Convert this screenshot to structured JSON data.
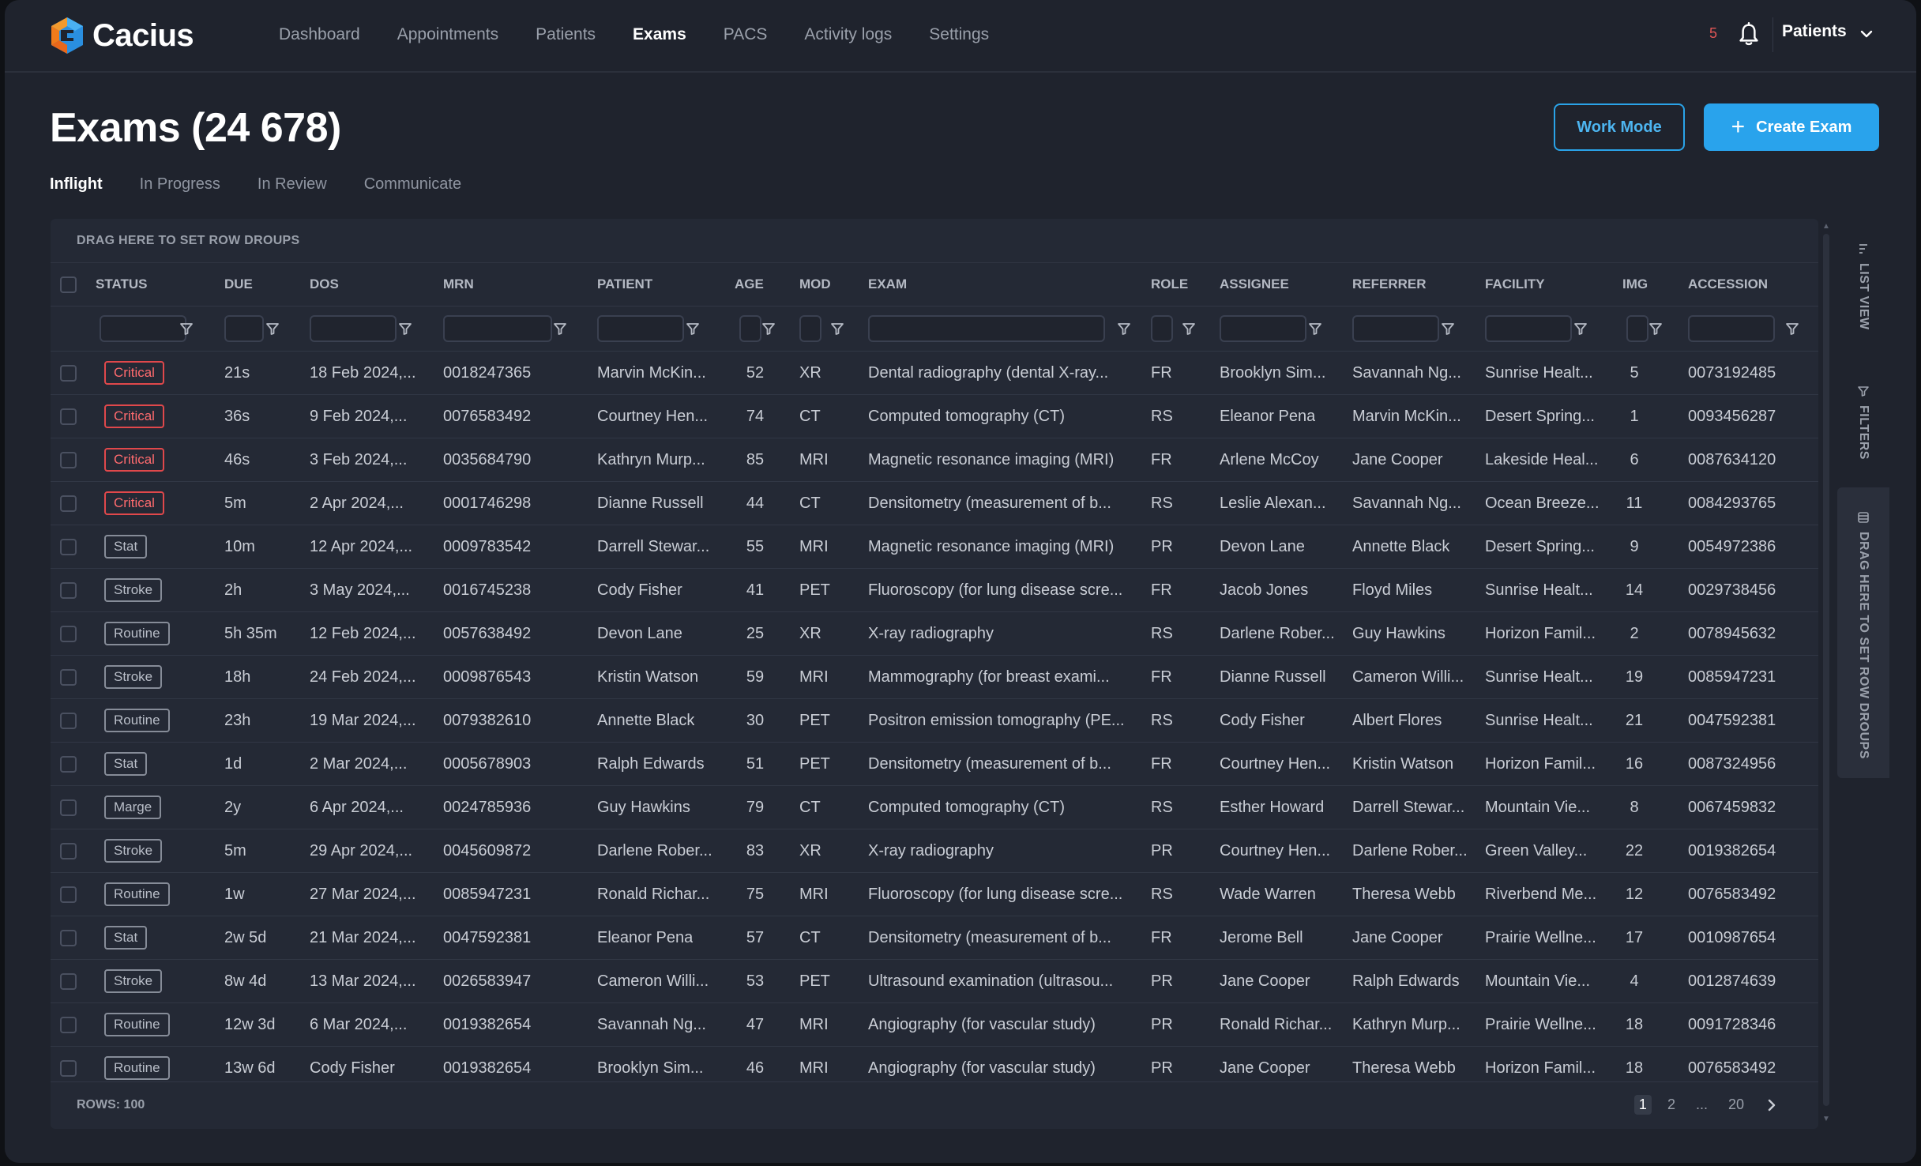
{
  "app": {
    "brand": "Cacius",
    "nav": [
      "Dashboard",
      "Appointments",
      "Patients",
      "Exams",
      "PACS",
      "Activity logs",
      "Settings"
    ],
    "nav_active": "Exams",
    "notification_count": "5",
    "profile_label": "Patients"
  },
  "page": {
    "title": "Exams (24 678)",
    "work_mode_label": "Work Mode",
    "create_label": "Create Exam",
    "tabs": [
      "Inflight",
      "In Progress",
      "In Review",
      "Communicate"
    ],
    "active_tab": "Inflight"
  },
  "grid": {
    "drop_zone_label": "DRAG HERE TO SET ROW DROUPS",
    "columns": [
      "STATUS",
      "DUE",
      "DOS",
      "MRN",
      "PATIENT",
      "AGE",
      "MOD",
      "EXAM",
      "ROLE",
      "ASSIGNEE",
      "REFERRER",
      "FACILITY",
      "IMG",
      "ACCESSION"
    ],
    "rows": [
      {
        "status": "Critical",
        "due": "21s",
        "dos": "18 Feb 2024,...",
        "mrn": "0018247365",
        "patient": "Marvin McKin...",
        "age": "52",
        "mod": "XR",
        "exam": "Dental radiography (dental X-ray...",
        "role": "FR",
        "assignee": "Brooklyn Sim...",
        "referrer": "Savannah Ng...",
        "facility": "Sunrise Healt...",
        "img": "5",
        "accession": "0073192485"
      },
      {
        "status": "Critical",
        "due": "36s",
        "dos": "9 Feb 2024,...",
        "mrn": "0076583492",
        "patient": "Courtney Hen...",
        "age": "74",
        "mod": "CT",
        "exam": "Computed tomography (CT)",
        "role": "RS",
        "assignee": "Eleanor Pena",
        "referrer": "Marvin McKin...",
        "facility": "Desert Spring...",
        "img": "1",
        "accession": "0093456287"
      },
      {
        "status": "Critical",
        "due": "46s",
        "dos": "3 Feb 2024,...",
        "mrn": "0035684790",
        "patient": "Kathryn Murp...",
        "age": "85",
        "mod": "MRI",
        "exam": "Magnetic resonance imaging (MRI)",
        "role": "FR",
        "assignee": "Arlene McCoy",
        "referrer": "Jane Cooper",
        "facility": "Lakeside Heal...",
        "img": "6",
        "accession": "0087634120"
      },
      {
        "status": "Critical",
        "due": "5m",
        "dos": "2 Apr 2024,...",
        "mrn": "0001746298",
        "patient": "Dianne Russell",
        "age": "44",
        "mod": "CT",
        "exam": "Densitometry (measurement of b...",
        "role": "RS",
        "assignee": "Leslie Alexan...",
        "referrer": "Savannah Ng...",
        "facility": "Ocean Breeze...",
        "img": "11",
        "accession": "0084293765"
      },
      {
        "status": "Stat",
        "due": "10m",
        "dos": "12 Apr 2024,...",
        "mrn": "0009783542",
        "patient": "Darrell Stewar...",
        "age": "55",
        "mod": "MRI",
        "exam": "Magnetic resonance imaging (MRI)",
        "role": "PR",
        "assignee": "Devon Lane",
        "referrer": "Annette Black",
        "facility": "Desert Spring...",
        "img": "9",
        "accession": "0054972386"
      },
      {
        "status": "Stroke",
        "due": "2h",
        "dos": "3 May 2024,...",
        "mrn": "0016745238",
        "patient": "Cody Fisher",
        "age": "41",
        "mod": "PET",
        "exam": "Fluoroscopy (for lung disease scre...",
        "role": "FR",
        "assignee": "Jacob Jones",
        "referrer": "Floyd Miles",
        "facility": "Sunrise Healt...",
        "img": "14",
        "accession": "0029738456"
      },
      {
        "status": "Routine",
        "due": "5h 35m",
        "dos": "12 Feb 2024,...",
        "mrn": "0057638492",
        "patient": "Devon Lane",
        "age": "25",
        "mod": "XR",
        "exam": "X-ray radiography",
        "role": "RS",
        "assignee": "Darlene Rober...",
        "referrer": "Guy Hawkins",
        "facility": "Horizon Famil...",
        "img": "2",
        "accession": "0078945632"
      },
      {
        "status": "Stroke",
        "due": "18h",
        "dos": "24 Feb 2024,...",
        "mrn": "0009876543",
        "patient": "Kristin Watson",
        "age": "59",
        "mod": "MRI",
        "exam": "Mammography (for breast exami...",
        "role": "FR",
        "assignee": "Dianne Russell",
        "referrer": "Cameron Willi...",
        "facility": "Sunrise Healt...",
        "img": "19",
        "accession": "0085947231"
      },
      {
        "status": "Routine",
        "due": "23h",
        "dos": "19 Mar 2024,...",
        "mrn": "0079382610",
        "patient": "Annette Black",
        "age": "30",
        "mod": "PET",
        "exam": "Positron emission tomography (PE...",
        "role": "RS",
        "assignee": "Cody Fisher",
        "referrer": "Albert Flores",
        "facility": "Sunrise Healt...",
        "img": "21",
        "accession": "0047592381"
      },
      {
        "status": "Stat",
        "due": "1d",
        "dos": "2 Mar 2024,...",
        "mrn": "0005678903",
        "patient": "Ralph Edwards",
        "age": "51",
        "mod": "PET",
        "exam": "Densitometry (measurement of b...",
        "role": "FR",
        "assignee": "Courtney Hen...",
        "referrer": "Kristin Watson",
        "facility": "Horizon Famil...",
        "img": "16",
        "accession": "0087324956"
      },
      {
        "status": "Marge",
        "due": "2y",
        "dos": "6 Apr 2024,...",
        "mrn": "0024785936",
        "patient": "Guy Hawkins",
        "age": "79",
        "mod": "CT",
        "exam": "Computed tomography (CT)",
        "role": "RS",
        "assignee": "Esther Howard",
        "referrer": "Darrell Stewar...",
        "facility": "Mountain Vie...",
        "img": "8",
        "accession": "0067459832"
      },
      {
        "status": "Stroke",
        "due": "5m",
        "dos": "29 Apr 2024,...",
        "mrn": "0045609872",
        "patient": "Darlene Rober...",
        "age": "83",
        "mod": "XR",
        "exam": "X-ray radiography",
        "role": "PR",
        "assignee": "Courtney Hen...",
        "referrer": "Darlene Rober...",
        "facility": "Green Valley...",
        "img": "22",
        "accession": "0019382654"
      },
      {
        "status": "Routine",
        "due": "1w",
        "dos": "27 Mar 2024,...",
        "mrn": "0085947231",
        "patient": "Ronald Richar...",
        "age": "75",
        "mod": "MRI",
        "exam": "Fluoroscopy (for lung disease scre...",
        "role": "RS",
        "assignee": "Wade Warren",
        "referrer": "Theresa Webb",
        "facility": "Riverbend Me...",
        "img": "12",
        "accession": "0076583492"
      },
      {
        "status": "Stat",
        "due": "2w 5d",
        "dos": "21 Mar 2024,...",
        "mrn": "0047592381",
        "patient": "Eleanor Pena",
        "age": "57",
        "mod": "CT",
        "exam": "Densitometry (measurement of b...",
        "role": "FR",
        "assignee": "Jerome Bell",
        "referrer": "Jane Cooper",
        "facility": "Prairie Wellne...",
        "img": "17",
        "accession": "0010987654"
      },
      {
        "status": "Stroke",
        "due": "8w 4d",
        "dos": "13 Mar 2024,...",
        "mrn": "0026583947",
        "patient": "Cameron Willi...",
        "age": "53",
        "mod": "PET",
        "exam": "Ultrasound examination (ultrasou...",
        "role": "PR",
        "assignee": "Jane Cooper",
        "referrer": "Ralph Edwards",
        "facility": "Mountain Vie...",
        "img": "4",
        "accession": "0012874639"
      },
      {
        "status": "Routine",
        "due": "12w 3d",
        "dos": "6 Mar 2024,...",
        "mrn": "0019382654",
        "patient": "Savannah Ng...",
        "age": "47",
        "mod": "MRI",
        "exam": "Angiography (for vascular study)",
        "role": "PR",
        "assignee": "Ronald Richar...",
        "referrer": "Kathryn Murp...",
        "facility": "Prairie Wellne...",
        "img": "18",
        "accession": "0091728346"
      },
      {
        "status": "Routine",
        "due": "13w 6d",
        "dos": "Cody Fisher",
        "mrn": "0019382654",
        "patient": "Brooklyn Sim...",
        "age": "46",
        "mod": "MRI",
        "exam": "Angiography (for vascular study)",
        "role": "PR",
        "assignee": "Jane Cooper",
        "referrer": "Theresa Webb",
        "facility": "Horizon Famil...",
        "img": "18",
        "accession": "0076583492"
      }
    ],
    "footer": {
      "rows_label": "ROWS: 100",
      "pages": [
        "1",
        "2",
        "...",
        "20"
      ],
      "current_page": "1"
    }
  },
  "side_panel": {
    "list_view_label": "LIST VIEW",
    "filters_label": "FILTERS",
    "row_groups_label": "DRAG HERE TO SET ROW DROUPS"
  },
  "colors": {
    "accent": "#29a3ec",
    "critical": "#e0484b",
    "background": "#1f232d"
  },
  "icons": [
    "logo-icon",
    "bell-icon",
    "chevron-down-icon",
    "filter-icon",
    "plus-icon",
    "chevron-right-icon",
    "list-view-icon",
    "filters-icon",
    "row-groups-icon"
  ]
}
